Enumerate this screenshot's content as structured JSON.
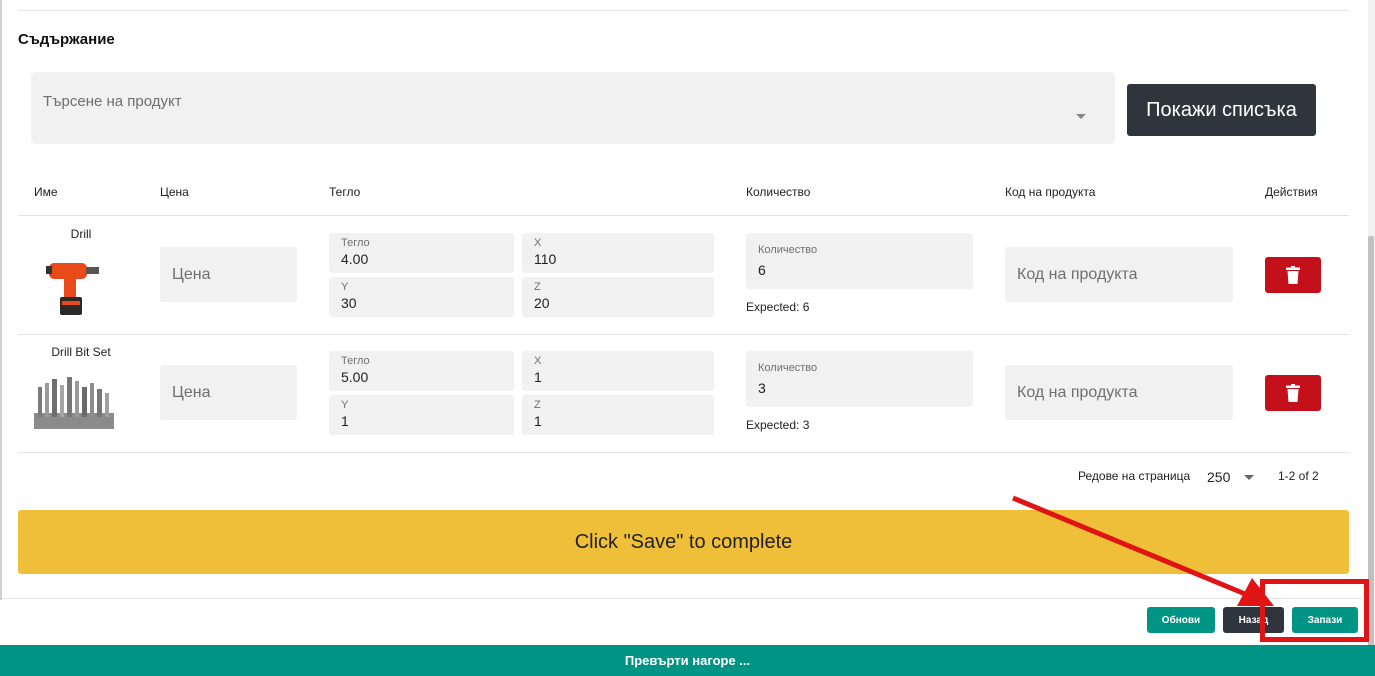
{
  "content": {
    "section_title": "Съдържание",
    "search": {
      "placeholder": "Търсене на продукт"
    },
    "show_list_label": "Покажи списъка"
  },
  "table": {
    "headers": [
      "Име",
      "Цена",
      "Тегло",
      "Количество",
      "Код на продукта",
      "Действия"
    ],
    "rows": [
      {
        "name": "Drill",
        "price_placeholder": "Цена",
        "weight_label": "Тегло",
        "weight": "4.00",
        "x_label": "X",
        "x": "110",
        "y_label": "Y",
        "y": "30",
        "z_label": "Z",
        "z": "20",
        "qty_label": "Количество",
        "qty": "6",
        "expected": "Expected: 6",
        "code_placeholder": "Код на продукта"
      },
      {
        "name": "Drill Bit Set",
        "price_placeholder": "Цена",
        "weight_label": "Тегло",
        "weight": "5.00",
        "x_label": "X",
        "x": "1",
        "y_label": "Y",
        "y": "1",
        "z_label": "Z",
        "z": "1",
        "qty_label": "Количество",
        "qty": "3",
        "expected": "Expected: 3",
        "code_placeholder": "Код на продукта"
      }
    ]
  },
  "pagination": {
    "rows_per_page_label": "Редове на страница",
    "rows_per_page": "250",
    "range": "1-2 of 2"
  },
  "banner": "Click \"Save\" to complete",
  "footer": {
    "refresh_label": "Обнови",
    "back_label": "Назад",
    "save_label": "Запази"
  },
  "scroll_top_label": "Превърти нагоре ...",
  "colors": {
    "dark_button": "#2e353d",
    "delete": "#c4101b",
    "banner": "#f0bf3a",
    "teal": "#009485",
    "highlight": "#e01414"
  },
  "icons": [
    "caret-down-icon",
    "trash-icon",
    "drill-image",
    "drill-bit-set-image"
  ]
}
